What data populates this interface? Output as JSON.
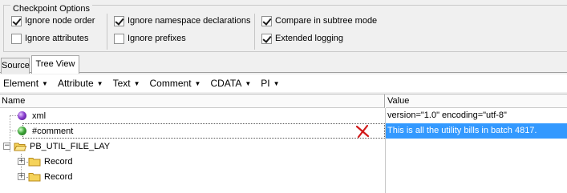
{
  "options": {
    "title": "Checkpoint Options",
    "items": [
      {
        "label": "Ignore node order",
        "checked": true
      },
      {
        "label": "Ignore attributes",
        "checked": false
      },
      {
        "label": "Ignore namespace declarations",
        "checked": true
      },
      {
        "label": "Ignore prefixes",
        "checked": false
      },
      {
        "label": "Compare in subtree mode",
        "checked": true
      },
      {
        "label": "Extended logging",
        "checked": true
      }
    ]
  },
  "tabs": [
    {
      "label": "Source",
      "active": false
    },
    {
      "label": "Tree View",
      "active": true
    }
  ],
  "toolbar": {
    "items": [
      "Element",
      "Attribute",
      "Text",
      "Comment",
      "CDATA",
      "PI"
    ]
  },
  "tree": {
    "headers": {
      "name": "Name",
      "value": "Value"
    },
    "rows": [
      {
        "name": "xml",
        "value": "version=\"1.0\" encoding=\"utf-8\""
      },
      {
        "name": "#comment",
        "value": "This is all the utility bills in batch 4817."
      },
      {
        "name": "PB_UTIL_FILE_LAY",
        "value": ""
      },
      {
        "name": "Record",
        "value": ""
      },
      {
        "name": "Record",
        "value": ""
      }
    ]
  },
  "colors": {
    "selection": "#3399ff",
    "delete_mark": "#d11a1a"
  }
}
